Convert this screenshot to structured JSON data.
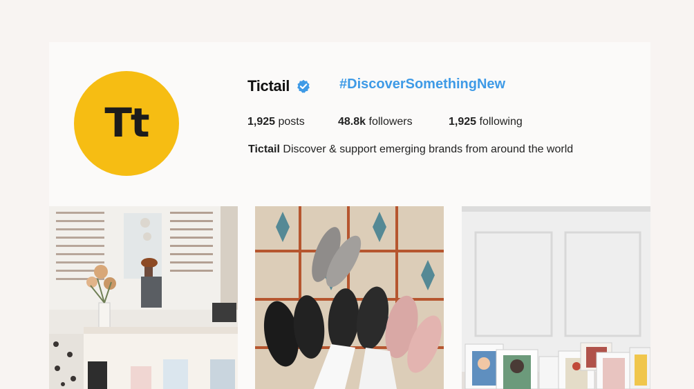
{
  "profile": {
    "username": "Tictail",
    "avatar_text": "Tt",
    "hashtag": "#DiscoverSomethingNew",
    "stats": [
      {
        "value": "1,925",
        "label": "posts"
      },
      {
        "value": "48.8k",
        "label": "followers"
      },
      {
        "value": "1,925",
        "label": "following"
      }
    ],
    "bio_name": "Tictail",
    "bio_text": "Discover & support emerging brands from around the world",
    "verified_icon": "verified-badge-icon"
  },
  "colors": {
    "page_bg": "#f8f4f2",
    "card_bg": "#fbfaf9",
    "avatar_bg": "#f6bd13",
    "link": "#3e9ae6",
    "verified": "#3e9ae6"
  },
  "posts": [
    {
      "name": "shop-interior-photo"
    },
    {
      "name": "shoes-on-tiles-photo"
    },
    {
      "name": "framed-art-photo"
    }
  ]
}
